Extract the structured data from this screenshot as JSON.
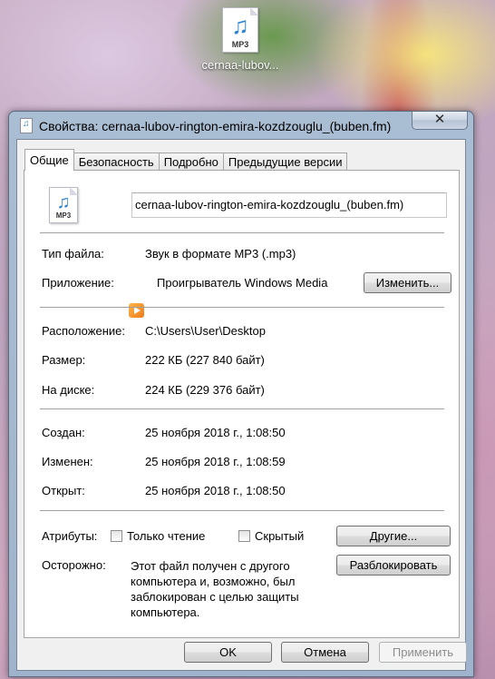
{
  "desktop": {
    "icon_badge": "MP3",
    "icon_caption": "cernaa-lubov..."
  },
  "window": {
    "title": "Свойства: cernaa-lubov-rington-emira-kozdzouglu_(buben.fm)",
    "close_glyph": "✕"
  },
  "tabs": [
    {
      "label": "Общие"
    },
    {
      "label": "Безопасность"
    },
    {
      "label": "Подробно"
    },
    {
      "label": "Предыдущие версии"
    }
  ],
  "general": {
    "file_badge": "MP3",
    "file_name": "cernaa-lubov-rington-emira-kozdzouglu_(buben.fm)",
    "file_type_label": "Тип файла:",
    "file_type_value": "Звук в формате MP3 (.mp3)",
    "app_label": "Приложение:",
    "app_value": "Проигрыватель Windows Media",
    "change_button": "Изменить...",
    "location_label": "Расположение:",
    "location_value": "C:\\Users\\User\\Desktop",
    "size_label": "Размер:",
    "size_value": "222 КБ (227 840 байт)",
    "disk_label": "На диске:",
    "disk_value": "224 КБ (229 376 байт)",
    "created_label": "Создан:",
    "created_value": "25 ноября 2018 г., 1:08:50",
    "modified_label": "Изменен:",
    "modified_value": "25 ноября 2018 г., 1:08:59",
    "opened_label": "Открыт:",
    "opened_value": "25 ноября 2018 г., 1:08:50",
    "attributes_label": "Атрибуты:",
    "readonly_label": "Только чтение",
    "readonly_checked": false,
    "hidden_label": "Скрытый",
    "hidden_checked": false,
    "other_button": "Другие...",
    "caution_label": "Осторожно:",
    "caution_text": "Этот файл получен с другого компьютера и, возможно, был заблокирован с целью защиты компьютера.",
    "unblock_button": "Разблокировать"
  },
  "footer": {
    "ok": "OK",
    "cancel": "Отмена",
    "apply": "Применить"
  }
}
